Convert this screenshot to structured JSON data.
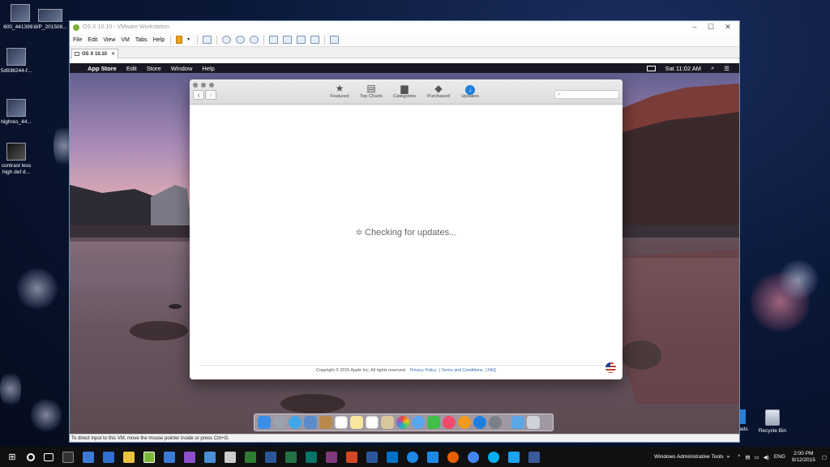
{
  "desktop": {
    "icons": [
      {
        "label": "600_441399...",
        "icon": "image-file-icon"
      },
      {
        "label": "WP_201508...",
        "icon": "image-file-icon"
      },
      {
        "label": "5d936244-f...",
        "icon": "image-file-icon"
      },
      {
        "label": "highres_44...",
        "icon": "image-file-icon"
      },
      {
        "label": "contrast less high def d...",
        "icon": "image-file-icon"
      },
      {
        "label": "loads",
        "icon": "downloads-icon"
      },
      {
        "label": "Recycle Bin",
        "icon": "recycle-bin-icon"
      }
    ]
  },
  "vmware": {
    "title": "OS X 10.10 - VMware Workstation",
    "menu": [
      "File",
      "Edit",
      "View",
      "VM",
      "Tabs",
      "Help"
    ],
    "tab_label": "OS X 10.10",
    "status_text": "To direct input to this VM, move the mouse pointer inside or press Ctrl+G."
  },
  "osx": {
    "menubar": {
      "app_name": "App Store",
      "items": [
        "Edit",
        "Store",
        "Window",
        "Help"
      ],
      "clock": "Sat 11:02 AM"
    },
    "appstore": {
      "tabs": [
        {
          "label": "Featured",
          "icon": "star-icon"
        },
        {
          "label": "Top Charts",
          "icon": "list-icon"
        },
        {
          "label": "Categories",
          "icon": "box-icon"
        },
        {
          "label": "Purchased",
          "icon": "tag-icon"
        },
        {
          "label": "Updates",
          "icon": "download-icon",
          "active": true
        }
      ],
      "search_placeholder": "",
      "status": "Checking for updates...",
      "footer": {
        "copyright": "Copyright © 2015 Apple Inc. All rights reserved.",
        "privacy": "Privacy Policy",
        "terms": "Terms and Conditions",
        "faq": "FAQ"
      }
    }
  },
  "taskbar": {
    "toolbar_label": "Windows Administrative Tools",
    "language": "ENG",
    "time": "2:00 PM",
    "date": "9/12/2015"
  },
  "colors": {
    "accent": "#1f7fe0",
    "taskbar": "#101010",
    "vmware_border": "#6f8fb5"
  }
}
